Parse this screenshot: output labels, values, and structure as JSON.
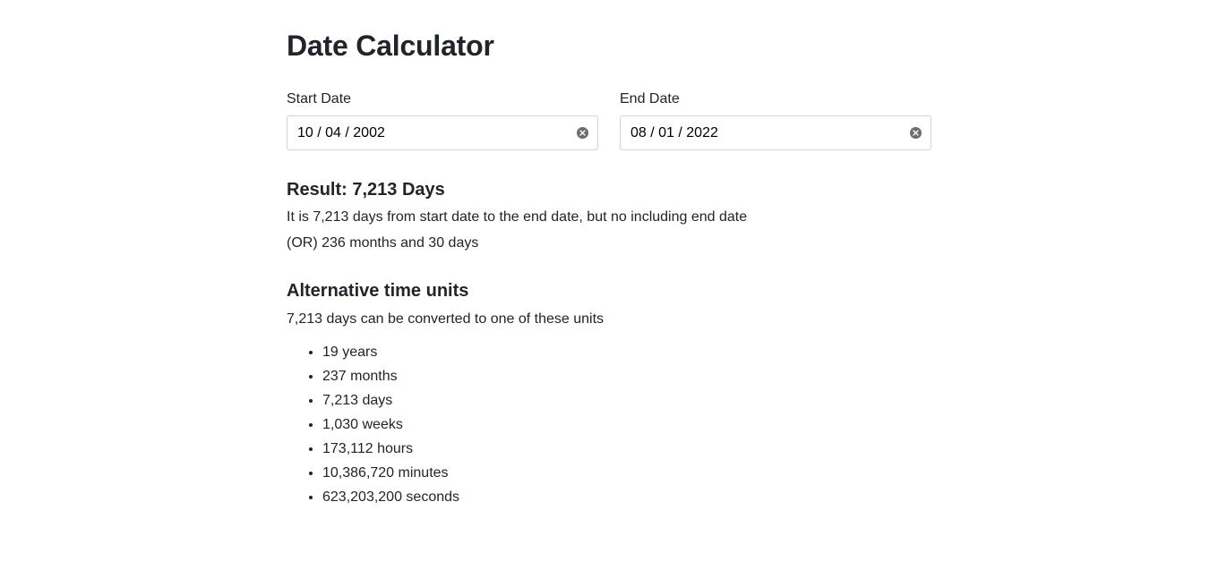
{
  "page_title": "Date Calculator",
  "start_date": {
    "label": "Start Date",
    "value": "10 / 04 / 2002"
  },
  "end_date": {
    "label": "End Date",
    "value": "08 / 01 / 2022"
  },
  "result": {
    "title": "Result: 7,213 Days",
    "description": "It is 7,213 days from start date to the end date, but no including end date",
    "alternative": "(OR) 236 months and 30 days"
  },
  "alternative_units": {
    "title": "Alternative time units",
    "description": "7,213 days can be converted to one of these units",
    "items": [
      "19 years",
      "237 months",
      "7,213 days",
      "1,030 weeks",
      "173,112 hours",
      "10,386,720 minutes",
      "623,203,200 seconds"
    ]
  },
  "icons": {
    "clear": "clear-icon"
  },
  "colors": {
    "text": "#212529",
    "input_border": "#ced4da",
    "clear_icon": "#6c6c6c"
  }
}
